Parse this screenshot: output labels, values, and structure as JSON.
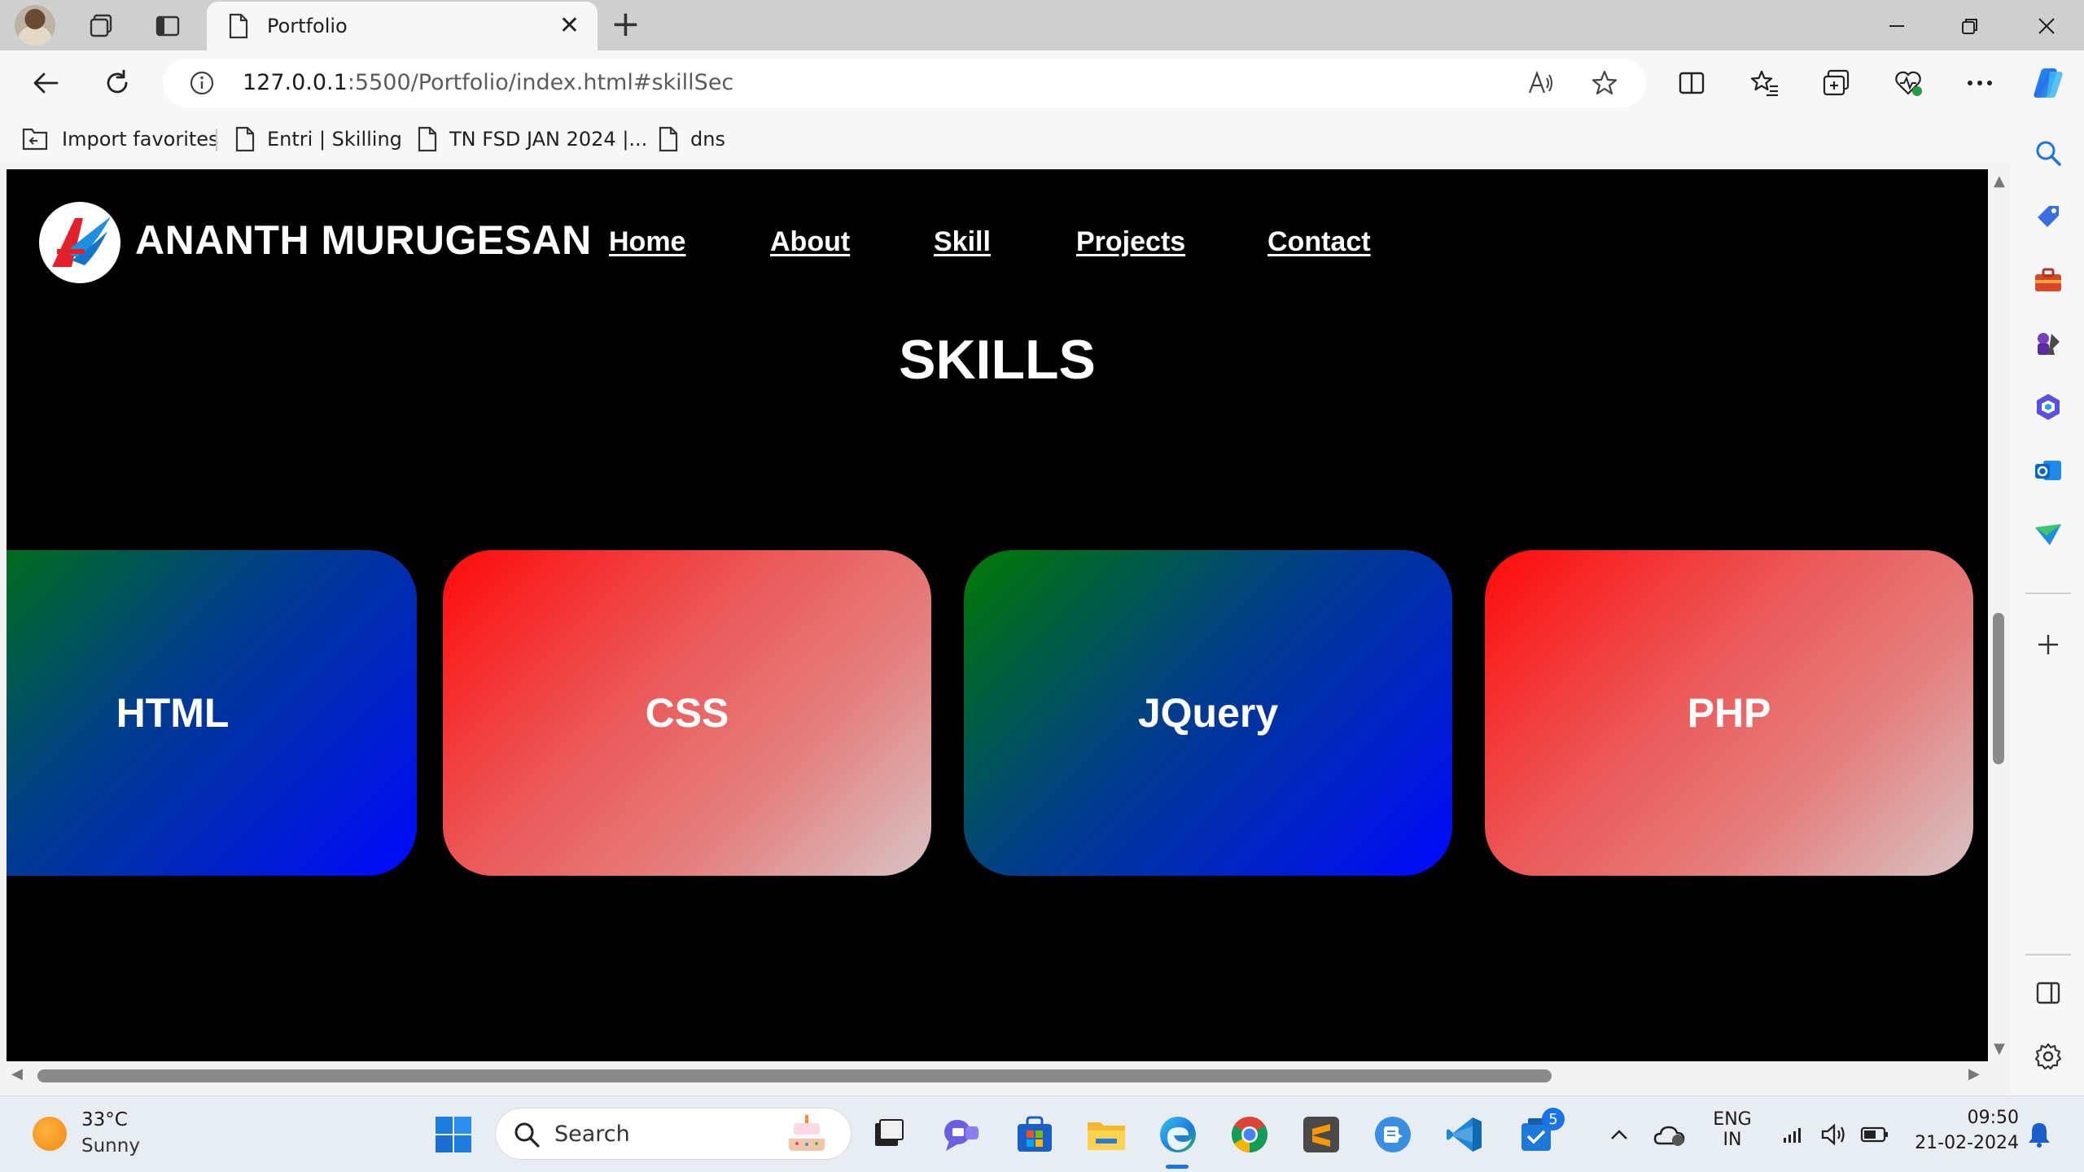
{
  "browser": {
    "tab": {
      "title": "Portfolio",
      "close": "✕"
    },
    "new_tab": "+",
    "address": {
      "host": "127.0.0.1",
      "rest": ":5500/Portfolio/index.html#skillSec"
    },
    "favorites": [
      {
        "label": "Import favorites",
        "icon": "import-icon"
      },
      {
        "label": "Entri | Skilling",
        "icon": "page-icon"
      },
      {
        "label": "TN FSD JAN 2024 |...",
        "icon": "page-icon"
      },
      {
        "label": "dns",
        "icon": "page-icon"
      }
    ],
    "accent": "#1a73e8"
  },
  "page": {
    "brand": "ANANTH MURUGESAN",
    "nav": [
      "Home",
      "About",
      "Skill",
      "Projects",
      "Contact"
    ],
    "section_title": "SKILLS",
    "skills": [
      "HTML",
      "CSS",
      "JQuery",
      "PHP"
    ],
    "colors": {
      "background": "#000000",
      "blue_gradient": [
        "#007a00",
        "#0008ff"
      ],
      "red_gradient": [
        "#ff0a0a",
        "#d8c4c4"
      ]
    }
  },
  "taskbar": {
    "weather": {
      "temp": "33°C",
      "desc": "Sunny"
    },
    "search_label": "Search",
    "language": {
      "line1": "ENG",
      "line2": "IN"
    },
    "clock": {
      "time": "09:50",
      "date": "21-02-2024"
    },
    "badge_count": "5"
  }
}
